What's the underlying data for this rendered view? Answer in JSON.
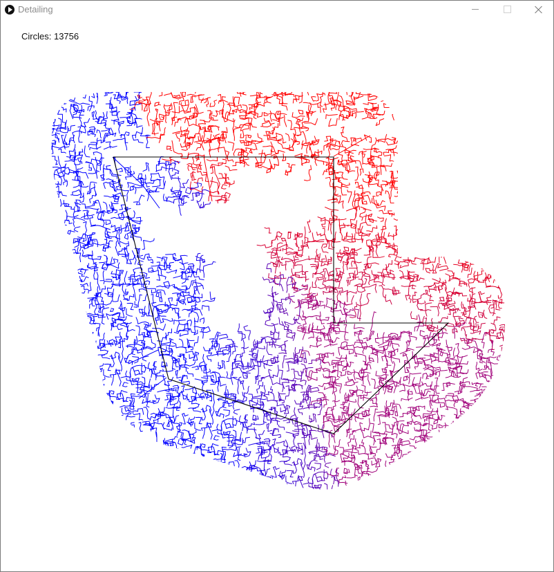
{
  "window": {
    "title": "Detailing",
    "icon": "play-icon",
    "controls": {
      "minimize_icon": "minimize-icon",
      "maximize_icon": "maximize-icon",
      "close_icon": "close-icon"
    }
  },
  "sketch": {
    "counter_label": "Circles:",
    "counter_value": "13756",
    "colors": {
      "start": "#ff0000",
      "middle": "#a0007a",
      "end": "#0000ff",
      "outline": "#000000",
      "background": "#ffffff"
    }
  }
}
